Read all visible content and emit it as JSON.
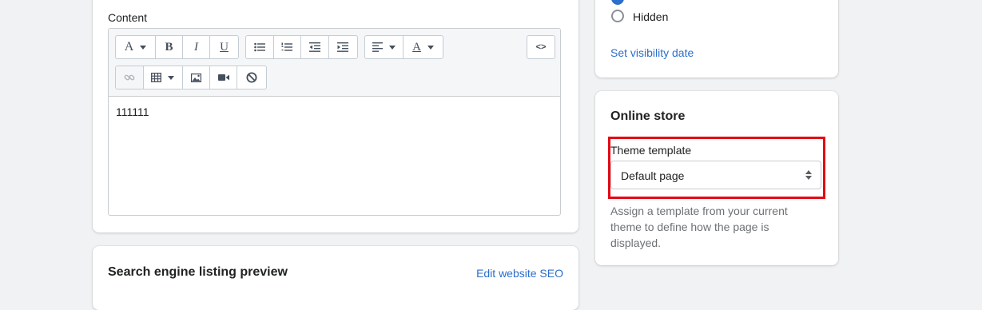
{
  "content": {
    "label": "Content",
    "body_text": "111111",
    "toolbar": {
      "html_label": "<>"
    }
  },
  "seo": {
    "title": "Search engine listing preview",
    "edit_link": "Edit website SEO"
  },
  "visibility": {
    "hidden_label": "Hidden",
    "set_date_link": "Set visibility date"
  },
  "online_store": {
    "title": "Online store",
    "template_label": "Theme template",
    "template_value": "Default page",
    "help_text": "Assign a template from your current theme to define how the page is displayed."
  },
  "colors": {
    "accent": "#2c6ecb",
    "highlight": "#e50914"
  }
}
